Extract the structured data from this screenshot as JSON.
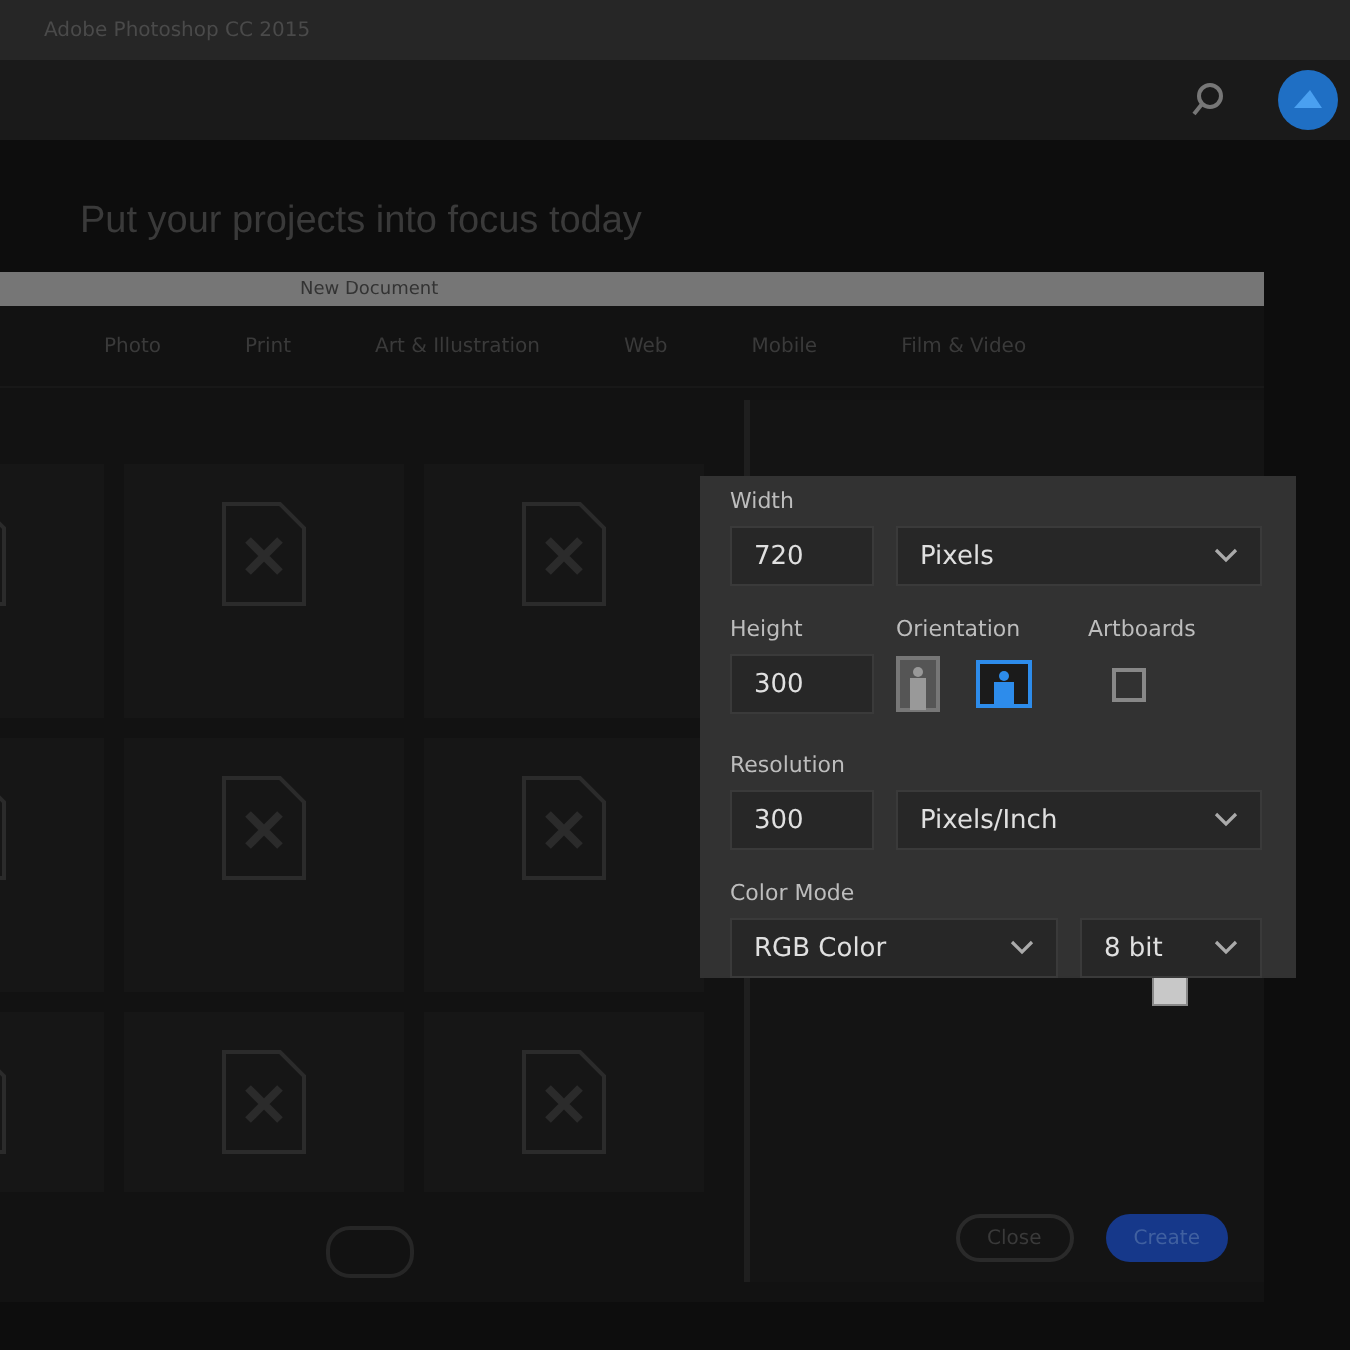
{
  "app_title": "Adobe Photoshop CC 2015",
  "headline": "Put your projects into focus today",
  "dialog": {
    "title": "New Document",
    "tabs": [
      {
        "label": "Photo",
        "selected": false
      },
      {
        "label": "Print",
        "selected": false
      },
      {
        "label": "Art & Illustration",
        "selected": false
      },
      {
        "label": "Web",
        "selected": false
      },
      {
        "label": "Mobile",
        "selected": false
      },
      {
        "label": "Film & Video",
        "selected": false
      }
    ],
    "buttons": [
      {
        "label": "Close",
        "kind": "secondary"
      },
      {
        "label": "Create",
        "kind": "primary"
      }
    ]
  },
  "settings": {
    "width": {
      "label": "Width",
      "value": "720",
      "unit": "Pixels"
    },
    "height": {
      "label": "Height",
      "value": "300"
    },
    "orientation": {
      "label": "Orientation",
      "options": [
        {
          "kind": "portrait",
          "selected": false
        },
        {
          "kind": "landscape",
          "selected": true
        }
      ]
    },
    "artboards": {
      "label": "Artboards",
      "checked": false
    },
    "resolution": {
      "label": "Resolution",
      "value": "300",
      "unit": "Pixels/Inch"
    },
    "color_mode": {
      "label": "Color Mode",
      "mode": "RGB Color",
      "depth": "8 bit"
    }
  }
}
